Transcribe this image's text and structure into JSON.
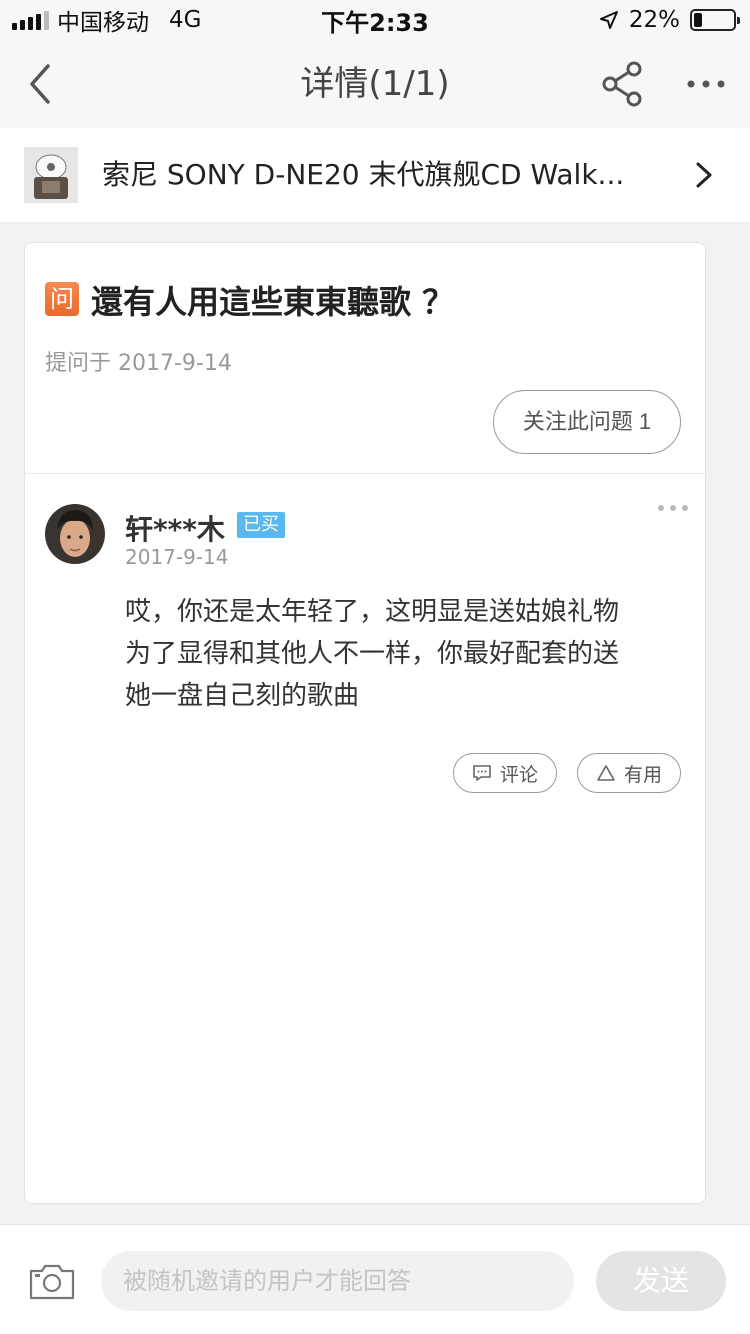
{
  "status_bar": {
    "carrier": "中国移动",
    "network": "4G",
    "time": "下午2:33",
    "battery_text": "22%",
    "battery_level": 0.22,
    "signal_icon": "signal-bars-icon",
    "location_icon": "location-arrow-icon"
  },
  "nav": {
    "title": "详情(1/1)",
    "back_icon": "back-chevron-icon",
    "share_icon": "share-icon",
    "more_icon": "more-dots-icon"
  },
  "product": {
    "title": "索尼 SONY D-NE20 末代旗舰CD Walk...",
    "chevron_icon": "chevron-right-icon"
  },
  "question": {
    "badge": "问",
    "title": "還有人用這些東東聽歌 ？",
    "date": "提问于 2017-9-14",
    "follow_label": "关注此问题 1"
  },
  "answer": {
    "user": "轩***木",
    "bought_badge": "已买",
    "date": "2017-9-14",
    "body_lines": [
      "哎，你还是太年轻了，这明显是送姑娘礼物",
      "为了显得和其他人不一样，你最好配套的送",
      "她一盘自己刻的歌曲"
    ],
    "comment_label": "评论",
    "useful_label": "有用"
  },
  "bottom_bar": {
    "camera_icon": "camera-icon",
    "input_placeholder": "被随机邀请的用户才能回答",
    "send_label": "发送"
  },
  "colors": {
    "accent_orange": "#ea6a2c",
    "bought_blue": "#5bb8ee",
    "disabled_send": "#e4e4e4"
  }
}
